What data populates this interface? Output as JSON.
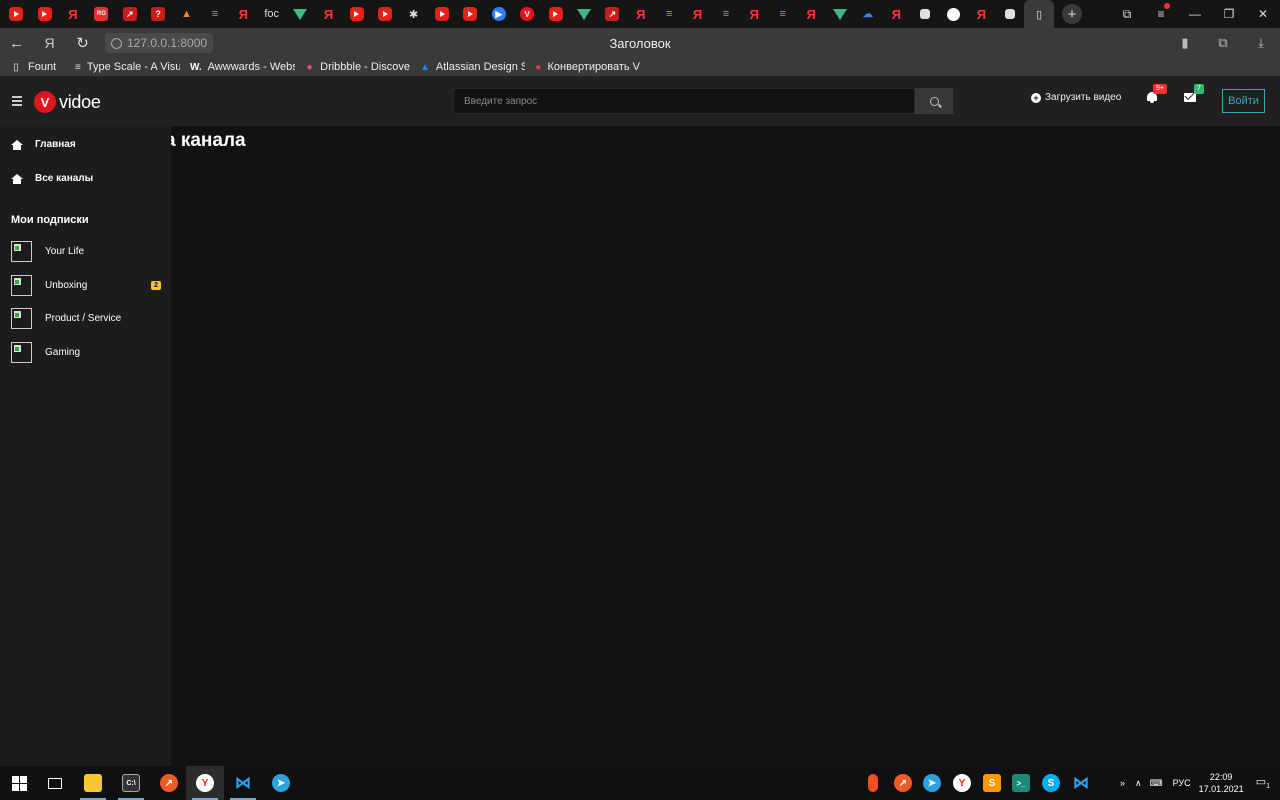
{
  "browser": {
    "tabs": [
      {
        "icon": "youtube-icon",
        "glyph": ""
      },
      {
        "icon": "youtube-icon",
        "glyph": ""
      },
      {
        "icon": "yandex-icon",
        "glyph": "Я"
      },
      {
        "icon": "researchgate-icon",
        "glyph": "RG"
      },
      {
        "icon": "tool-icon",
        "glyph": "↗"
      },
      {
        "icon": "question-icon",
        "glyph": "?"
      },
      {
        "icon": "triangle-icon",
        "glyph": "▲"
      },
      {
        "icon": "stackoverflow-icon",
        "glyph": "≡"
      },
      {
        "icon": "yandex-icon",
        "glyph": "Я"
      },
      {
        "icon": "text-icon",
        "glyph": "foc"
      },
      {
        "icon": "vue-icon",
        "glyph": ""
      },
      {
        "icon": "yandex-icon",
        "glyph": "Я"
      },
      {
        "icon": "youtube-icon",
        "glyph": ""
      },
      {
        "icon": "youtube-icon",
        "glyph": ""
      },
      {
        "icon": "puzzle-icon",
        "glyph": "✱"
      },
      {
        "icon": "youtube-icon",
        "glyph": ""
      },
      {
        "icon": "youtube-icon",
        "glyph": ""
      },
      {
        "icon": "play-icon",
        "glyph": "▶"
      },
      {
        "icon": "vivaldi-icon",
        "glyph": "V"
      },
      {
        "icon": "youtube-icon",
        "glyph": ""
      },
      {
        "icon": "vue-icon",
        "glyph": ""
      },
      {
        "icon": "tool-icon",
        "glyph": "↗"
      },
      {
        "icon": "yandex-icon",
        "glyph": "Я"
      },
      {
        "icon": "stackoverflow-icon",
        "glyph": "≡"
      },
      {
        "icon": "yandex-icon",
        "glyph": "Я"
      },
      {
        "icon": "stackoverflow-icon",
        "glyph": "≡"
      },
      {
        "icon": "yandex-icon",
        "glyph": "Я"
      },
      {
        "icon": "stackoverflow-icon",
        "glyph": "≡"
      },
      {
        "icon": "yandex-icon",
        "glyph": "Я"
      },
      {
        "icon": "vue-icon",
        "glyph": ""
      },
      {
        "icon": "cloud-icon",
        "glyph": "☁"
      },
      {
        "icon": "yandex-icon",
        "glyph": "Я"
      },
      {
        "icon": "cube-icon",
        "glyph": ""
      },
      {
        "icon": "github-icon",
        "glyph": ""
      },
      {
        "icon": "yandex-icon",
        "glyph": "Я"
      },
      {
        "icon": "cube-icon",
        "glyph": ""
      }
    ],
    "address": "127.0.0.1:8000",
    "page_title": "Заголовок",
    "bookmarks": [
      {
        "label": "Fount",
        "icon": "page-icon",
        "glyph": "▯",
        "color": "#aaaaaa"
      },
      {
        "label": "Type Scale - A Visu",
        "icon": "typescale-icon",
        "glyph": "≡",
        "color": "#dddddd"
      },
      {
        "label": "Awwwards - Websi",
        "icon": "awwwards-icon",
        "glyph": "W.",
        "color": "#ffffff"
      },
      {
        "label": "Dribbble - Discove",
        "icon": "dribbble-icon",
        "glyph": "●",
        "color": "#ea4c89"
      },
      {
        "label": "Atlassian Design Sy",
        "icon": "atlassian-icon",
        "glyph": "▲",
        "color": "#2684ff"
      },
      {
        "label": "Конвертировать V",
        "icon": "convert-icon",
        "glyph": "●",
        "color": "#e63946"
      }
    ]
  },
  "app": {
    "logo_mark": "V",
    "logo_word": "vidoe",
    "search_placeholder": "Введите запрос",
    "upload_label": "Загрузить видео",
    "notifications_badge": "9+",
    "messages_badge": "7",
    "login_label": "Войти",
    "colors": {
      "brand": "#e0141c",
      "accent": "#3aa7b8",
      "badge_yellow": "#f5c518"
    }
  },
  "sidebar": {
    "nav": [
      {
        "label": "Главная",
        "icon": "home-icon"
      },
      {
        "label": "Все каналы",
        "icon": "home-icon"
      }
    ],
    "subscriptions_title": "Мои подписки",
    "subscriptions": [
      {
        "name": "Your Life",
        "count": ""
      },
      {
        "name": "Unboxing",
        "count": "2"
      },
      {
        "name": "Product / Service",
        "count": ""
      },
      {
        "name": "Gaming",
        "count": ""
      }
    ]
  },
  "main": {
    "title": "а канала"
  },
  "taskbar": {
    "language": "РУС",
    "time": "22:09",
    "date": "17.01.2021",
    "notifications_count": "1"
  }
}
